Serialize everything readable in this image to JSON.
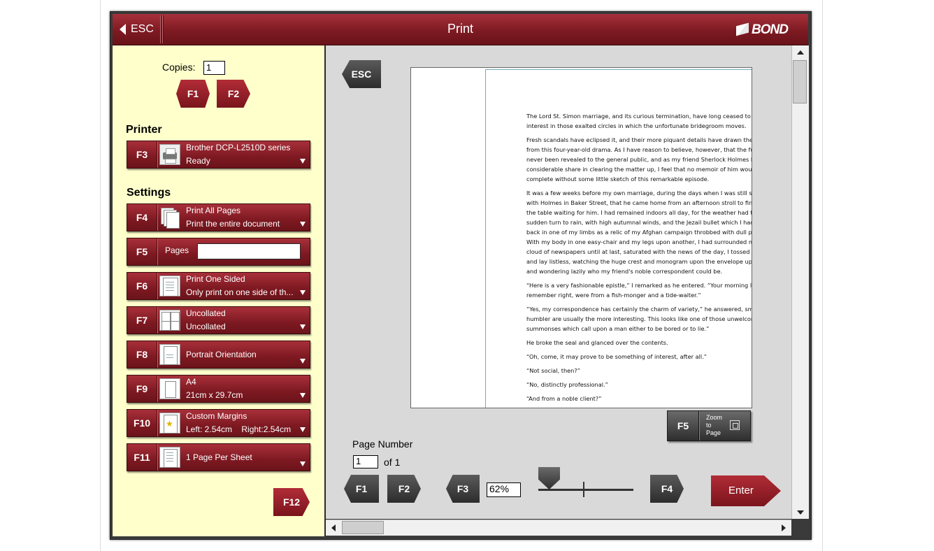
{
  "window": {
    "title": "Print",
    "esc_label": "ESC",
    "brand": "BOND"
  },
  "copies": {
    "label": "Copies:",
    "value": "1"
  },
  "copies_buttons": {
    "f1": "F1",
    "f2": "F2"
  },
  "printer": {
    "heading": "Printer",
    "key": "F3",
    "name": "Brother DCP-L2510D series",
    "status": "Ready"
  },
  "settings": {
    "heading": "Settings",
    "pages_range": {
      "key": "F4",
      "line1": "Print All Pages",
      "line2": "Print the entire document"
    },
    "pages_input": {
      "key": "F5",
      "label": "Pages",
      "value": ""
    },
    "sides": {
      "key": "F6",
      "line1": "Print One Sided",
      "line2": "Only print on one side of th..."
    },
    "collation": {
      "key": "F7",
      "line1": "Uncollated",
      "line2": "Uncollated"
    },
    "orientation": {
      "key": "F8",
      "line1": "Portrait Orientation"
    },
    "paper": {
      "key": "F9",
      "line1": "A4",
      "line2": "21cm x 29.7cm"
    },
    "margins": {
      "key": "F10",
      "line1": "Custom Margins",
      "line2": "Left: 2.54cm    Right:2.54cm"
    },
    "pages_per_sheet": {
      "key": "F11",
      "line1": "1 Page Per Sheet"
    },
    "more_key": "F12"
  },
  "preview": {
    "esc_label": "ESC",
    "paragraphs": [
      "The Lord St. Simon marriage, and its curious termination, have long ceased to be\ninterest in those exalted circles in which the unfortunate bridegroom moves.",
      "Fresh scandals have eclipsed it, and their more piquant details have drawn the go\nfrom this four-year-old drama. As I have reason to believe, however, that the full\nnever been revealed to the general public, and as my friend Sherlock Holmes had\nconsiderable share in clearing the matter up, I feel that no memoir of him would\ncomplete without some little sketch of this remarkable episode.",
      "It was a few weeks before my own marriage, during the days when I was still shar\nwith Holmes in Baker Street, that he came home from an afternoon stroll to find\nthe table waiting for him. I had remained indoors all day, for the weather had tak\nsudden turn to rain, with high autumnal winds, and the Jezail bullet which I had b\nback in one of my limbs as a relic of my Afghan campaign throbbed with dull pers\nWith my body in one easy-chair and my legs upon another, I had surrounded mys\ncloud of newspapers until at last, saturated with the news of the day, I tossed the\nand lay listless, watching the huge crest and monogram upon the envelope upon\nand wondering lazily who my friend's noble correspondent could be.",
      "“Here is a very fashionable epistle,” I remarked as he entered. “Your morning lett\nremember right, were from a fish-monger and a tide-waiter.”",
      "“Yes, my correspondence has certainly the charm of variety,” he answered, smilin\nhumbler are usually the more interesting. This looks like one of those unwelcom\nsummonses which call upon a man either to be bored or to lie.”",
      "He broke the seal and glanced over the contents.",
      "“Oh, come, it may prove to be something of interest, after all.”",
      "“Not social, then?”",
      "“No, distinctly professional.”",
      "“And from a noble client?”"
    ],
    "zoom_to_page": {
      "key": "F5",
      "label": "Zoom\nto\nPage"
    }
  },
  "page_nav": {
    "label": "Page Number",
    "value": "1",
    "of_text": "of 1",
    "prev_key": "F1",
    "next_key": "F2"
  },
  "zoom": {
    "out_key": "F3",
    "value": "62%",
    "in_key": "F4",
    "level_pct": 62
  },
  "enter_label": "Enter"
}
